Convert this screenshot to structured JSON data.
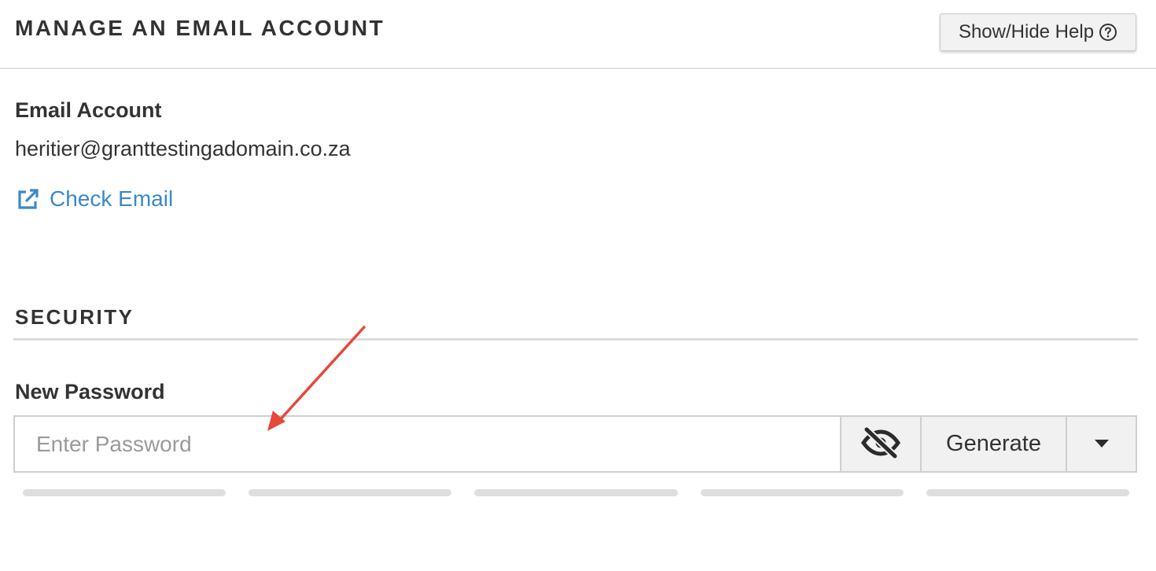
{
  "header": {
    "title": "MANAGE AN EMAIL ACCOUNT",
    "help_button_label": "Show/Hide Help",
    "help_icon": "question-circle-icon"
  },
  "email_account": {
    "label": "Email Account",
    "address": "heritier@granttestingadomain.co.za",
    "check_email_label": "Check Email",
    "check_email_icon": "external-link-icon",
    "link_color": "#3b88c9"
  },
  "security": {
    "section_title": "SECURITY",
    "new_password_label": "New Password",
    "password_input": {
      "value": "",
      "placeholder": "Enter Password"
    },
    "toggle_visibility_icon": "eye-slash-icon",
    "generate_label": "Generate",
    "dropdown_icon": "caret-down-icon",
    "strength_meter": {
      "segments": 5,
      "filled_segments": 0
    }
  },
  "annotation": {
    "arrow_color": "#e5493a",
    "arrow_icon": "red-arrow-annotation"
  }
}
